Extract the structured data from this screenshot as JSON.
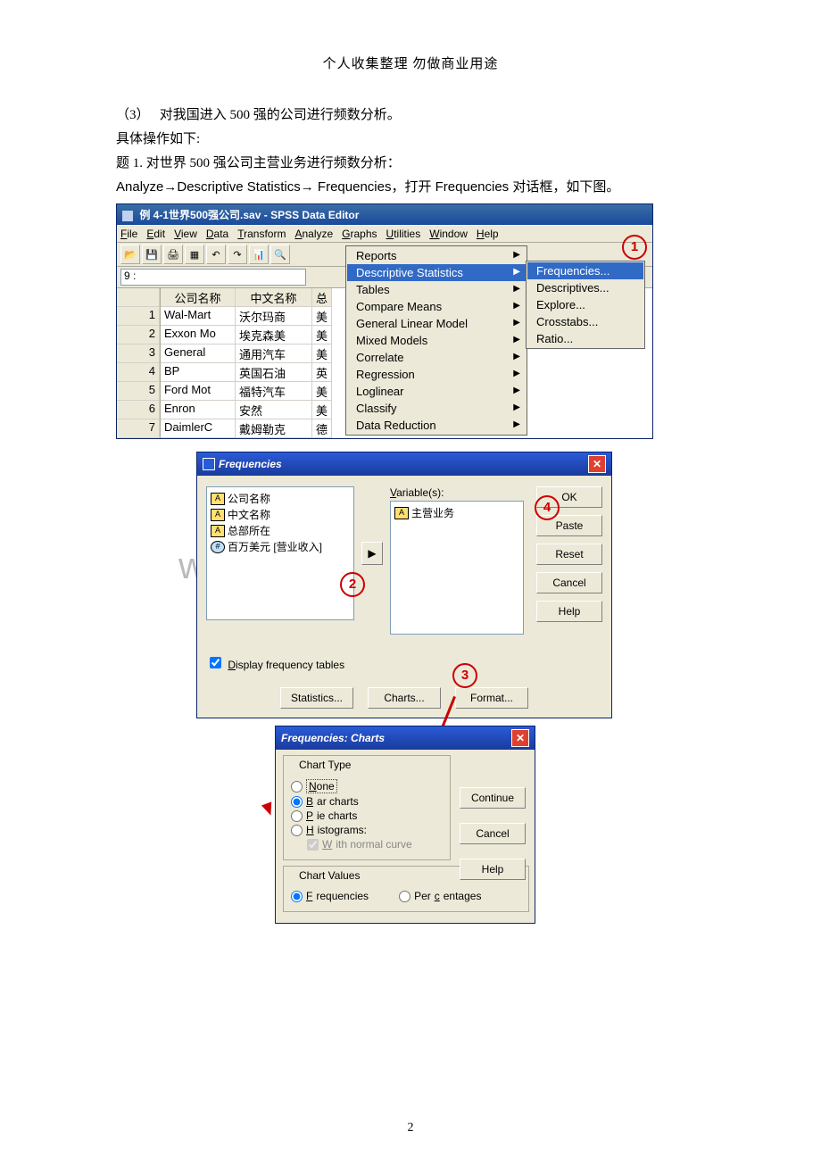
{
  "header": "个人收集整理 勿做商业用途",
  "para1_prefix": "（3）",
  "para1": "对我国进入 500 强的公司进行频数分析。",
  "para2": "具体操作如下:",
  "para3": "题 1. 对世界 500 强公司主营业务进行频数分析：",
  "para4_pre": "Analyze",
  "para4_mid": "Descriptive Statistics",
  "para4_end": " Frequencies，打开 Frequencies 对话框，如下图。",
  "arrow_glyph": "→",
  "spss": {
    "title": "例 4-1世界500强公司.sav - SPSS Data Editor",
    "menus": [
      "File",
      "Edit",
      "View",
      "Data",
      "Transform",
      "Analyze",
      "Graphs",
      "Utilities",
      "Window",
      "Help"
    ],
    "addr_label": "9 :",
    "cols": [
      "公司名称",
      "中文名称",
      "总"
    ],
    "rows": [
      {
        "n": "1",
        "a": "Wal-Mart",
        "b": "沃尔玛商",
        "c": "美"
      },
      {
        "n": "2",
        "a": "Exxon Mo",
        "b": "埃克森美",
        "c": "美"
      },
      {
        "n": "3",
        "a": "General",
        "b": "通用汽车",
        "c": "美"
      },
      {
        "n": "4",
        "a": "BP",
        "b": "英国石油",
        "c": "英"
      },
      {
        "n": "5",
        "a": "Ford Mot",
        "b": "福特汽车",
        "c": "美"
      },
      {
        "n": "6",
        "a": "Enron",
        "b": "安然",
        "c": "美"
      },
      {
        "n": "7",
        "a": "DaimlerC",
        "b": "戴姆勒克",
        "c": "德"
      }
    ],
    "analyze_menu": [
      "Reports",
      "Descriptive Statistics",
      "Tables",
      "Compare Means",
      "General Linear Model",
      "Mixed Models",
      "Correlate",
      "Regression",
      "Loglinear",
      "Classify",
      "Data Reduction"
    ],
    "desc_sub": [
      "Frequencies...",
      "Descriptives...",
      "Explore...",
      "Crosstabs...",
      "Ratio..."
    ]
  },
  "callouts": {
    "c1": "1",
    "c2": "2",
    "c3": "3",
    "c4": "4"
  },
  "freq_dlg": {
    "title": "Frequencies",
    "vars": [
      "公司名称",
      "中文名称",
      "总部所在",
      "百万美元 [营业收入]"
    ],
    "target_label": "Variable(s):",
    "target_item": "主营业务",
    "buttons": [
      "OK",
      "Paste",
      "Reset",
      "Cancel",
      "Help"
    ],
    "display_chk": "Display frequency tables",
    "bottom": [
      "Statistics...",
      "Charts...",
      "Format..."
    ]
  },
  "charts_dlg": {
    "title": "Frequencies: Charts",
    "type_legend": "Chart Type",
    "types": [
      "None",
      "Bar charts",
      "Pie charts",
      "Histograms:"
    ],
    "normal": "With normal curve",
    "values_legend": "Chart Values",
    "values": [
      "Frequencies",
      "Percentages"
    ],
    "buttons": [
      "Continue",
      "Cancel",
      "Help"
    ]
  },
  "watermark": "wWw.zixin.com.cn",
  "page_num": "2"
}
